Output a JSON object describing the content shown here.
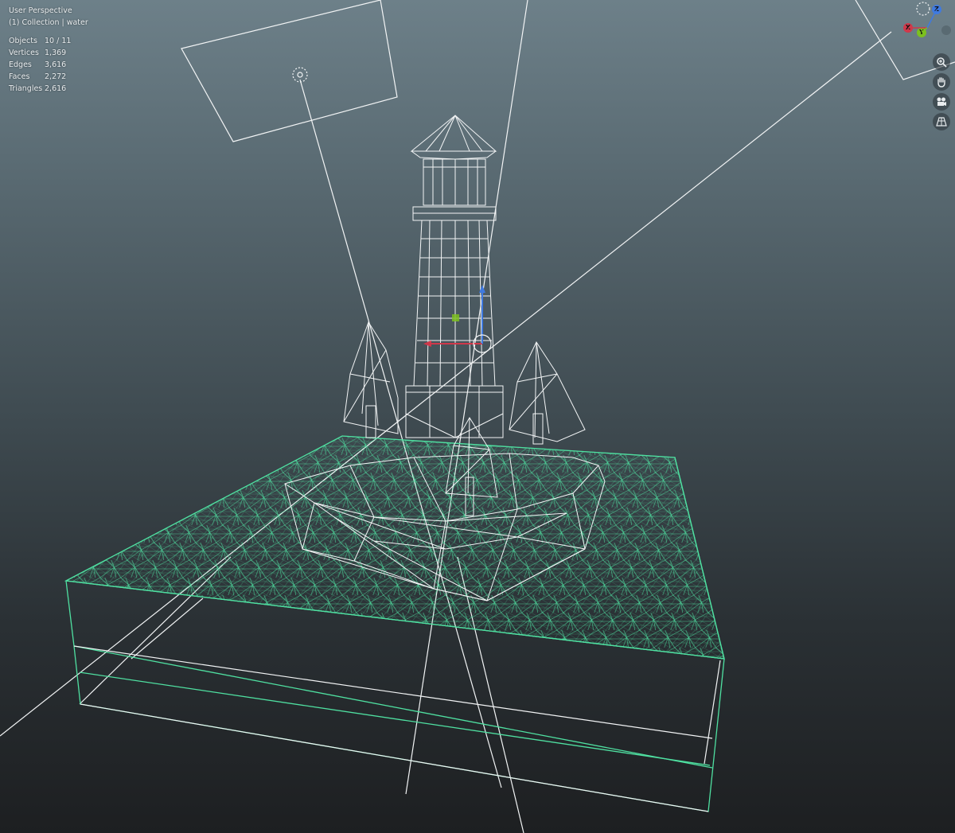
{
  "viewport": {
    "view_name": "User Perspective",
    "collection_label": "(1) Collection | water"
  },
  "statistics": [
    {
      "label": "Objects",
      "value": "10 / 11"
    },
    {
      "label": "Vertices",
      "value": "1,369"
    },
    {
      "label": "Edges",
      "value": "3,616"
    },
    {
      "label": "Faces",
      "value": "2,272"
    },
    {
      "label": "Triangles",
      "value": "2,616"
    }
  ],
  "gizmo": {
    "axes": [
      {
        "name": "z-axis",
        "label": "Z",
        "color": "#3f7ae0"
      },
      {
        "name": "x-axis",
        "label": "X",
        "color": "#d0384a"
      },
      {
        "name": "y-axis",
        "label": "Y",
        "color": "#7cc01e"
      }
    ]
  },
  "nav_buttons": [
    {
      "name": "zoom-icon",
      "label": "Zoom"
    },
    {
      "name": "pan-hand-icon",
      "label": "Move"
    },
    {
      "name": "camera-view-icon",
      "label": "Camera"
    },
    {
      "name": "perspective-grid-icon",
      "label": "Perspective"
    }
  ],
  "colors": {
    "wire_selected": "#4fe0a1",
    "wire_default": "#f2f4f5",
    "axis_x": "#d0384a",
    "axis_y": "#7cc01e",
    "axis_z": "#3f7ae0"
  }
}
